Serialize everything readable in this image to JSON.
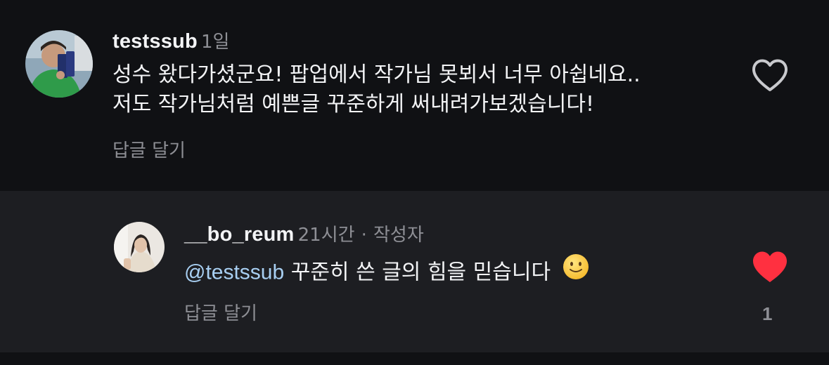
{
  "comments": [
    {
      "username": "testssub",
      "time": "1일",
      "body_lines": [
        "성수 왔다가셨군요! 팝업에서 작가님 못뵈서 너무 아쉽네요..",
        "저도 작가님처럼 예쁜글 꾸준하게 써내려가보겠습니다!"
      ],
      "reply_label": "답글 달기",
      "liked": false,
      "avatar_icon": "user-photo-avatar"
    },
    {
      "username": "__bo_reum",
      "time": "21시간",
      "separator": "·",
      "author_tag": "작성자",
      "mention": "@testssub",
      "body": "꾸준히 쓴 글의 힘을 믿습니다",
      "emoji": "slightly-smiling-face-icon",
      "reply_label": "답글 달기",
      "liked": true,
      "like_count": "1",
      "avatar_icon": "user-photo-avatar"
    }
  ],
  "colors": {
    "background": "#101114",
    "reply_background": "#1d1e22",
    "text": "#f3f4f6",
    "muted": "#8e8f95",
    "mention": "#a8cff2",
    "like_active": "#ff3040",
    "like_inactive": "#c8c9cd"
  }
}
